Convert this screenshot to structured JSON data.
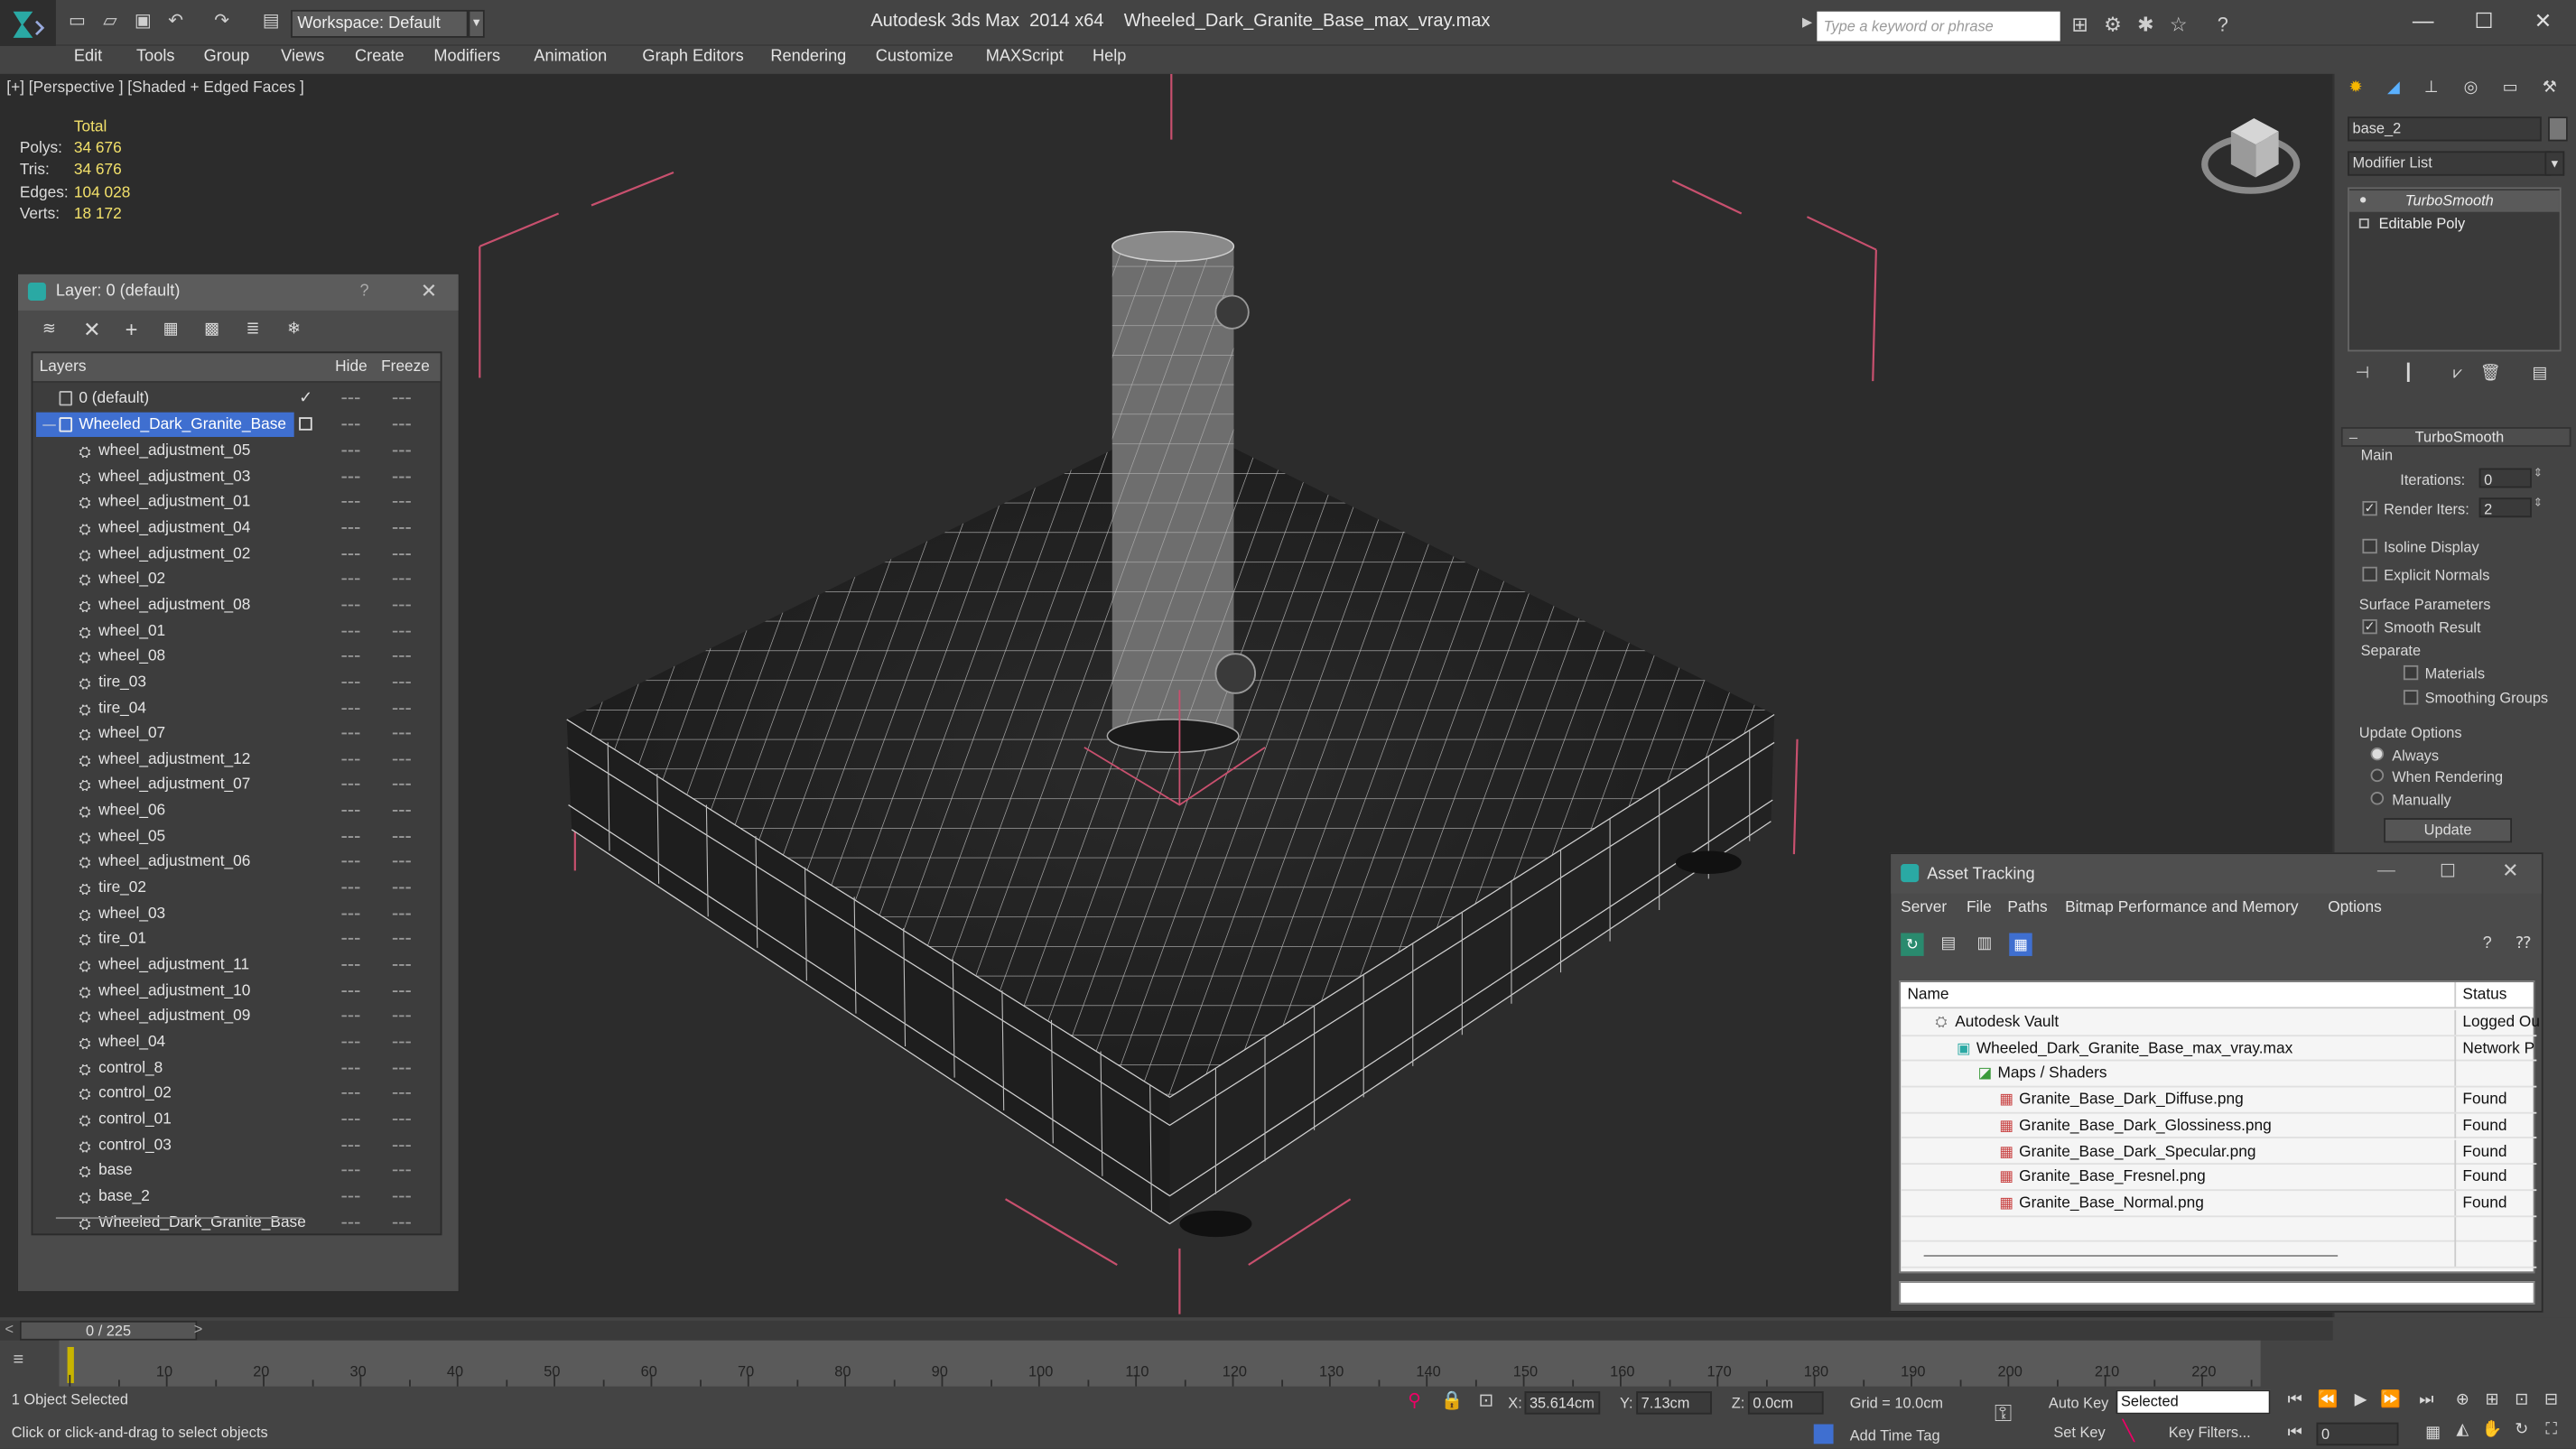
{
  "window": {
    "app_name": "Autodesk 3ds Max  2014 x64",
    "file_name": "Wheeled_Dark_Granite_Base_max_vray.max",
    "workspace": "Workspace: Default",
    "search_placeholder": "Type a keyword or phrase"
  },
  "menu": [
    "Edit",
    "Tools",
    "Group",
    "Views",
    "Create",
    "Modifiers",
    "Animation",
    "Graph Editors",
    "Rendering",
    "Customize",
    "MAXScript",
    "Help"
  ],
  "viewport": {
    "label": "[+] [Perspective ] [Shaded + Edged Faces ]",
    "stats_header": "Total",
    "stats": [
      {
        "label": "Polys:",
        "value": "34 676"
      },
      {
        "label": "Tris:",
        "value": "34 676"
      },
      {
        "label": "Edges:",
        "value": "104 028"
      },
      {
        "label": "Verts:",
        "value": "18 172"
      }
    ]
  },
  "layer_panel": {
    "title": "Layer: 0 (default)",
    "help": "?",
    "columns": {
      "layers": "Layers",
      "hide": "Hide",
      "freeze": "Freeze"
    },
    "default_layer": "0 (default)",
    "selected_layer": "Wheeled_Dark_Granite_Base",
    "objects": [
      "wheel_adjustment_05",
      "wheel_adjustment_03",
      "wheel_adjustment_01",
      "wheel_adjustment_04",
      "wheel_adjustment_02",
      "wheel_02",
      "wheel_adjustment_08",
      "wheel_01",
      "wheel_08",
      "tire_03",
      "tire_04",
      "wheel_07",
      "wheel_adjustment_12",
      "wheel_adjustment_07",
      "wheel_06",
      "wheel_05",
      "wheel_adjustment_06",
      "tire_02",
      "wheel_03",
      "tire_01",
      "wheel_adjustment_11",
      "wheel_adjustment_10",
      "wheel_adjustment_09",
      "wheel_04",
      "control_8",
      "control_02",
      "control_01",
      "control_03",
      "base",
      "base_2",
      "Wheeled_Dark_Granite_Base"
    ]
  },
  "command_panel": {
    "object_name": "base_2",
    "modifier_list": "Modifier List",
    "stack": [
      "TurboSmooth",
      "Editable Poly"
    ],
    "rollout_title": "TurboSmooth",
    "main_label": "Main",
    "iterations_label": "Iterations:",
    "iterations_value": "0",
    "render_iters_label": "Render Iters:",
    "render_iters_value": "2",
    "isoline": "Isoline Display",
    "explicit_normals": "Explicit Normals",
    "surface_params": "Surface Parameters",
    "smooth_result": "Smooth Result",
    "separate": "Separate",
    "materials": "Materials",
    "smoothing_groups": "Smoothing Groups",
    "update_options": "Update Options",
    "always": "Always",
    "when_rendering": "When Rendering",
    "manually": "Manually",
    "update_button": "Update"
  },
  "asset_tracking": {
    "title": "Asset Tracking",
    "menu": [
      "Server",
      "File",
      "Paths",
      "Bitmap Performance and Memory",
      "Options"
    ],
    "col_name": "Name",
    "col_status": "Status",
    "rows": [
      {
        "name": "Autodesk Vault",
        "status": "Logged Ou",
        "indent": 1,
        "icon": "vault-icon"
      },
      {
        "name": "Wheeled_Dark_Granite_Base_max_vray.max",
        "status": "Network P",
        "indent": 2,
        "icon": "max-file-icon"
      },
      {
        "name": "Maps / Shaders",
        "status": "",
        "indent": 3,
        "icon": "maps-icon"
      },
      {
        "name": "Granite_Base_Dark_Diffuse.png",
        "status": "Found",
        "indent": 4,
        "icon": "png-icon"
      },
      {
        "name": "Granite_Base_Dark_Glossiness.png",
        "status": "Found",
        "indent": 4,
        "icon": "png-icon"
      },
      {
        "name": "Granite_Base_Dark_Specular.png",
        "status": "Found",
        "indent": 4,
        "icon": "png-icon"
      },
      {
        "name": "Granite_Base_Fresnel.png",
        "status": "Found",
        "indent": 4,
        "icon": "png-icon"
      },
      {
        "name": "Granite_Base_Normal.png",
        "status": "Found",
        "indent": 4,
        "icon": "png-icon"
      }
    ]
  },
  "timeline": {
    "frame_counter": "0 / 225",
    "ticks": [
      10,
      20,
      30,
      40,
      50,
      60,
      70,
      80,
      90,
      100,
      110,
      120,
      130,
      140,
      150,
      160,
      170,
      180,
      190,
      200,
      210,
      220
    ]
  },
  "status": {
    "selection": "1 Object Selected",
    "prompt": "Click or click-and-drag to select objects",
    "x_label": "X:",
    "x_value": "35.614cm",
    "y_label": "Y:",
    "y_value": "7.13cm",
    "z_label": "Z:",
    "z_value": "0.0cm",
    "grid": "Grid = 10.0cm",
    "auto_key": "Auto Key",
    "set_key": "Set Key",
    "selected_dropdown": "Selected",
    "key_filters": "Key Filters...",
    "add_time_tag": "Add Time Tag",
    "frame_field": "0"
  },
  "colors": {
    "selection_blue": "#3f6fd0",
    "stat_yellow": "#f2e06a",
    "gizmo_pink": "#c8506e"
  }
}
